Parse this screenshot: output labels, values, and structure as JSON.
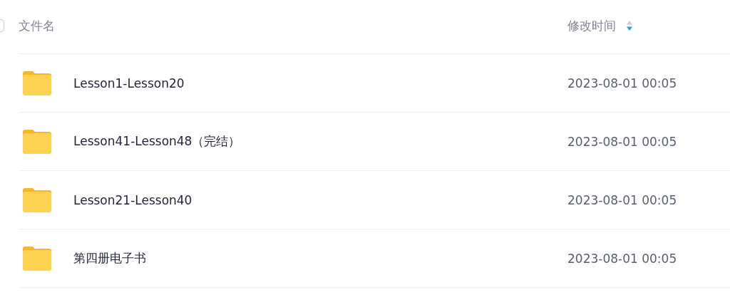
{
  "header": {
    "select_all": {
      "checked": false
    },
    "columns": [
      {
        "label": "文件名"
      },
      {
        "label": "修改时间",
        "sort_descending": true
      }
    ]
  },
  "rows": [
    {
      "name": "Lesson1-Lesson20",
      "modified": "2023-08-01 00:05"
    },
    {
      "name": "Lesson41-Lesson48（完结）",
      "modified": "2023-08-01 00:05"
    },
    {
      "name": "Lesson21-Lesson40",
      "modified": "2023-08-01 00:05"
    },
    {
      "name": "第四册电子书",
      "modified": "2023-08-01 00:05"
    }
  ]
}
